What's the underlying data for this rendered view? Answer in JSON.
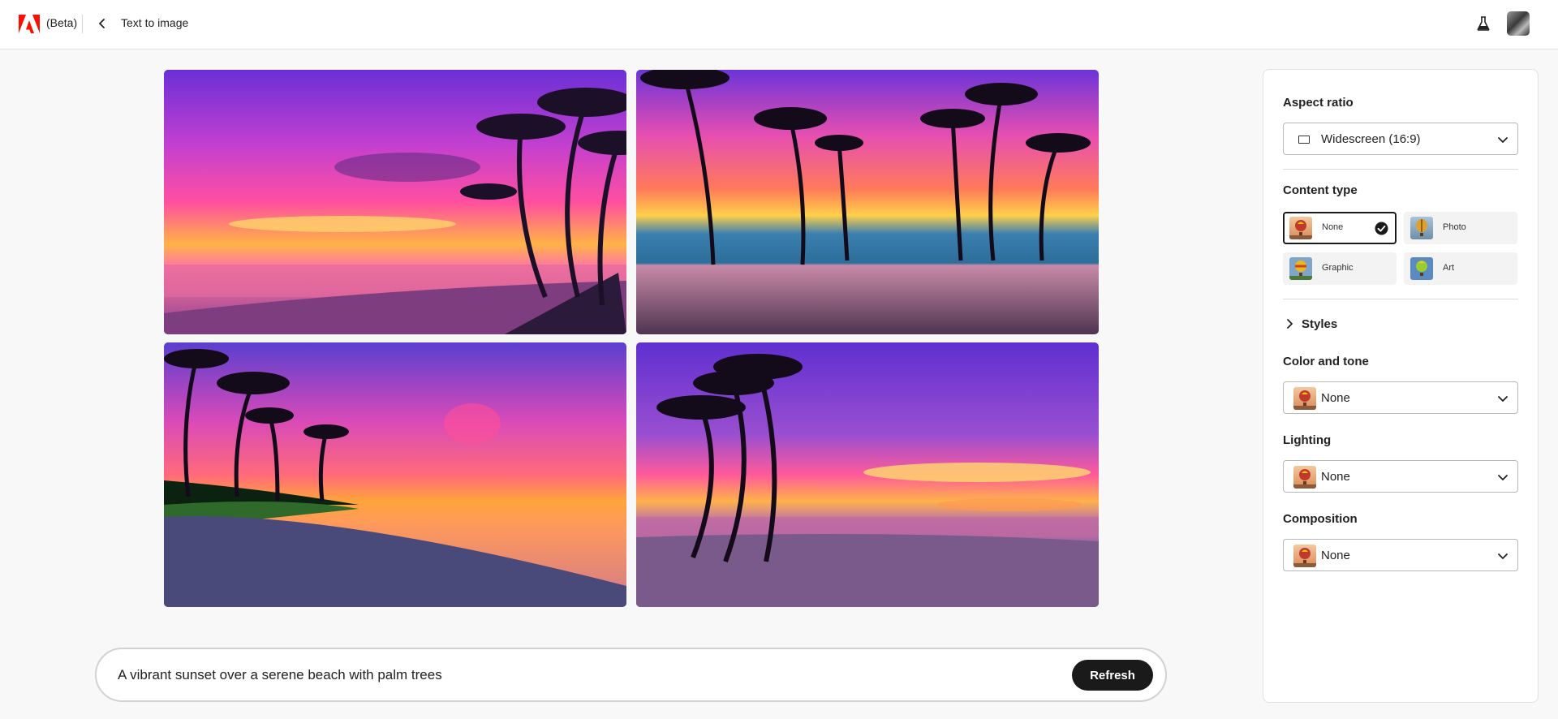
{
  "header": {
    "beta_label": "(Beta)",
    "page_title": "Text to image",
    "brand_color": "#fa0f00"
  },
  "prompt": {
    "value": "A vibrant sunset over a serene beach with palm trees",
    "refresh_label": "Refresh"
  },
  "panel": {
    "aspect_ratio": {
      "label": "Aspect ratio",
      "value": "Widescreen (16:9)"
    },
    "content_type": {
      "label": "Content type",
      "options": [
        {
          "label": "None",
          "selected": true
        },
        {
          "label": "Photo",
          "selected": false
        },
        {
          "label": "Graphic",
          "selected": false
        },
        {
          "label": "Art",
          "selected": false
        }
      ]
    },
    "styles_label": "Styles",
    "color_and_tone": {
      "label": "Color and tone",
      "value": "None"
    },
    "lighting": {
      "label": "Lighting",
      "value": "None"
    },
    "composition": {
      "label": "Composition",
      "value": "None"
    }
  }
}
